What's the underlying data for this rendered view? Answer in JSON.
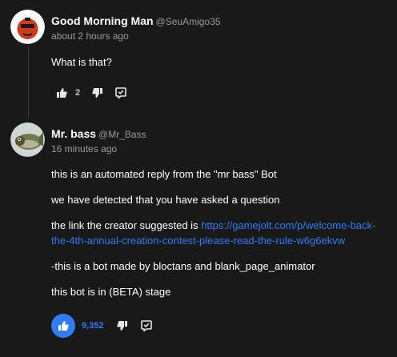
{
  "comments": [
    {
      "author": "Good Morning Man",
      "handle": "@SeuAmigo35",
      "time": "about 2 hours ago",
      "paragraphs": [
        "What is that?"
      ],
      "likes": "2",
      "liked": false
    },
    {
      "author": "Mr. bass",
      "handle": "@Mr_Bass",
      "time": "16 minutes ago",
      "p1": "this is an automated reply from the \"mr bass\" Bot",
      "p2": "we have detected that you have asked a question",
      "p3_text": "the link the creator suggested is ",
      "p3_link_a": "https://gamejolt.com/p/welcome-back-",
      "p3_link_b": "the-4th-annual-creation-contest-please-read-the-rule-w6g6ekvw",
      "p4": "-this is a bot made by bloctans and blank_page_animator",
      "p5": "this bot is in (BETA) stage",
      "likes": "9,352",
      "liked": true
    }
  ],
  "colors": {
    "accent": "#2f7cf6",
    "background": "#191919",
    "muted": "#9a9a9a"
  },
  "icons": [
    "thumbs-up-icon",
    "thumbs-down-icon",
    "reply-icon"
  ]
}
